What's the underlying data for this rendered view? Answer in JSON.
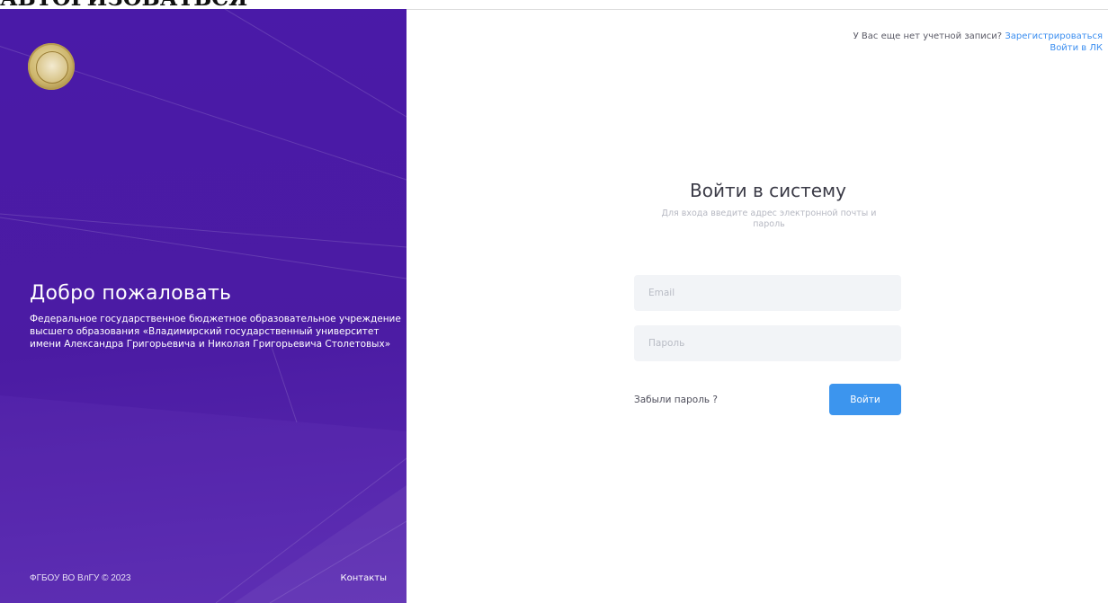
{
  "page": {
    "top_heading": "АВТОРИЗОВАТЬСЯ"
  },
  "left_panel": {
    "logo": "university-seal",
    "title": "Добро пожаловать",
    "description": "Федеральное государственное бюджетное образовательное учреждение высшего образования «Владимирский государственный университет имени Александра Григорьевича и Николая Григорьевича Столетовых»",
    "copyright": "ФГБОУ ВО ВлГУ © 2023",
    "contacts_link": "Контакты"
  },
  "header_links": {
    "no_account_text": "У Вас еще нет учетной записи?",
    "register_link": "Зарегистрироваться",
    "lk_login_link": "Войти в ЛК"
  },
  "login_form": {
    "title": "Войти в систему",
    "subtitle": "Для входа введите адрес электронной почты и пароль",
    "email_placeholder": "Email",
    "password_placeholder": "Пароль",
    "forgot_password": "Забыли пароль ?",
    "submit_label": "Войти"
  },
  "colors": {
    "panel_bg": "#4b1ba3",
    "accent": "#3c95ee",
    "field_bg": "#f2f4f7"
  }
}
